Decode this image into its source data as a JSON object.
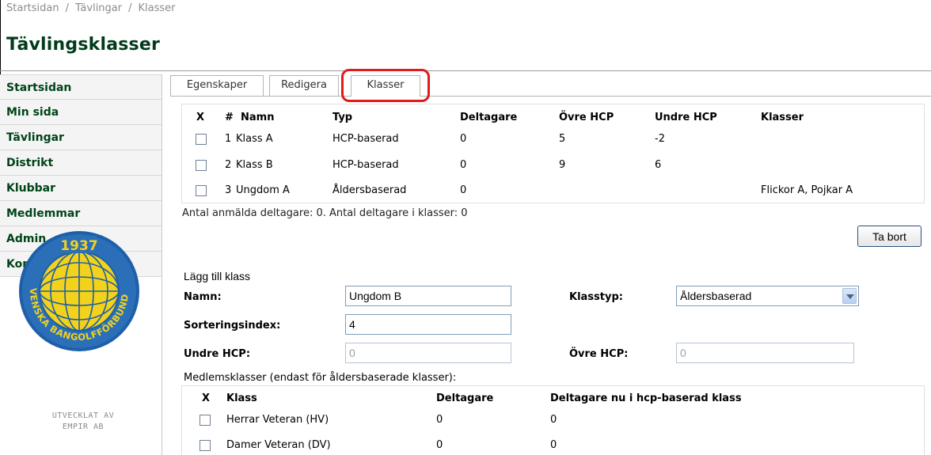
{
  "breadcrumb": [
    "Startsidan",
    "Tävlingar",
    "Klasser"
  ],
  "breadcrumb_separator": "/",
  "page_title": "Tävlingsklasser",
  "sidebar": {
    "items": [
      {
        "label": "Startsidan"
      },
      {
        "label": "Min sida"
      },
      {
        "label": "Tävlingar"
      },
      {
        "label": "Distrikt"
      },
      {
        "label": "Klubbar"
      },
      {
        "label": "Medlemmar"
      },
      {
        "label": "Admin"
      },
      {
        "label": "Kontakt"
      }
    ],
    "logo": {
      "year": "1937",
      "text": "SVENSKA BANGOLFFÖRBUNDET",
      "icon": "federation-logo-icon"
    },
    "credit_line1": "UTVECKLAT AV",
    "credit_line2": "EMPIR AB"
  },
  "tabs": [
    {
      "label": "Egenskaper",
      "active": false
    },
    {
      "label": "Redigera",
      "active": false
    },
    {
      "label": "Klasser",
      "active": true
    }
  ],
  "annotation_color": "#e21a1a",
  "class_table": {
    "headers": {
      "x": "X",
      "num": "#",
      "name": "Namn",
      "type": "Typ",
      "participants": "Deltagare",
      "upper_hcp": "Övre HCP",
      "lower_hcp": "Undre HCP",
      "classes": "Klasser"
    },
    "rows": [
      {
        "num": "1",
        "name": "Klass A",
        "type": "HCP-baserad",
        "participants": "0",
        "upper_hcp": "5",
        "lower_hcp": "-2",
        "classes": ""
      },
      {
        "num": "2",
        "name": "Klass B",
        "type": "HCP-baserad",
        "participants": "0",
        "upper_hcp": "9",
        "lower_hcp": "6",
        "classes": ""
      },
      {
        "num": "3",
        "name": "Ungdom A",
        "type": "Åldersbaserad",
        "participants": "0",
        "upper_hcp": "",
        "lower_hcp": "",
        "classes": "Flickor A, Pojkar A"
      }
    ]
  },
  "summary": "Antal anmälda deltagare: 0. Antal deltagare i klasser: 0",
  "delete_button": "Ta bort",
  "add_form": {
    "heading": "Lägg till klass",
    "name_label": "Namn:",
    "name_value": "Ungdom B",
    "classtype_label": "Klasstyp:",
    "classtype_value": "Åldersbaserad",
    "sort_label": "Sorteringsindex:",
    "sort_value": "4",
    "lower_hcp_label": "Undre HCP:",
    "lower_hcp_value": "0",
    "upper_hcp_label": "Övre HCP:",
    "upper_hcp_value": "0"
  },
  "member_classes": {
    "heading": "Medlemsklasser (endast för åldersbaserade klasser):",
    "headers": {
      "x": "X",
      "class": "Klass",
      "participants": "Deltagare",
      "in_hcp": "Deltagare nu i hcp-baserad klass"
    },
    "rows": [
      {
        "class": "Herrar Veteran (HV)",
        "participants": "0",
        "in_hcp": "0"
      },
      {
        "class": "Damer Veteran (DV)",
        "participants": "0",
        "in_hcp": "0"
      }
    ]
  }
}
